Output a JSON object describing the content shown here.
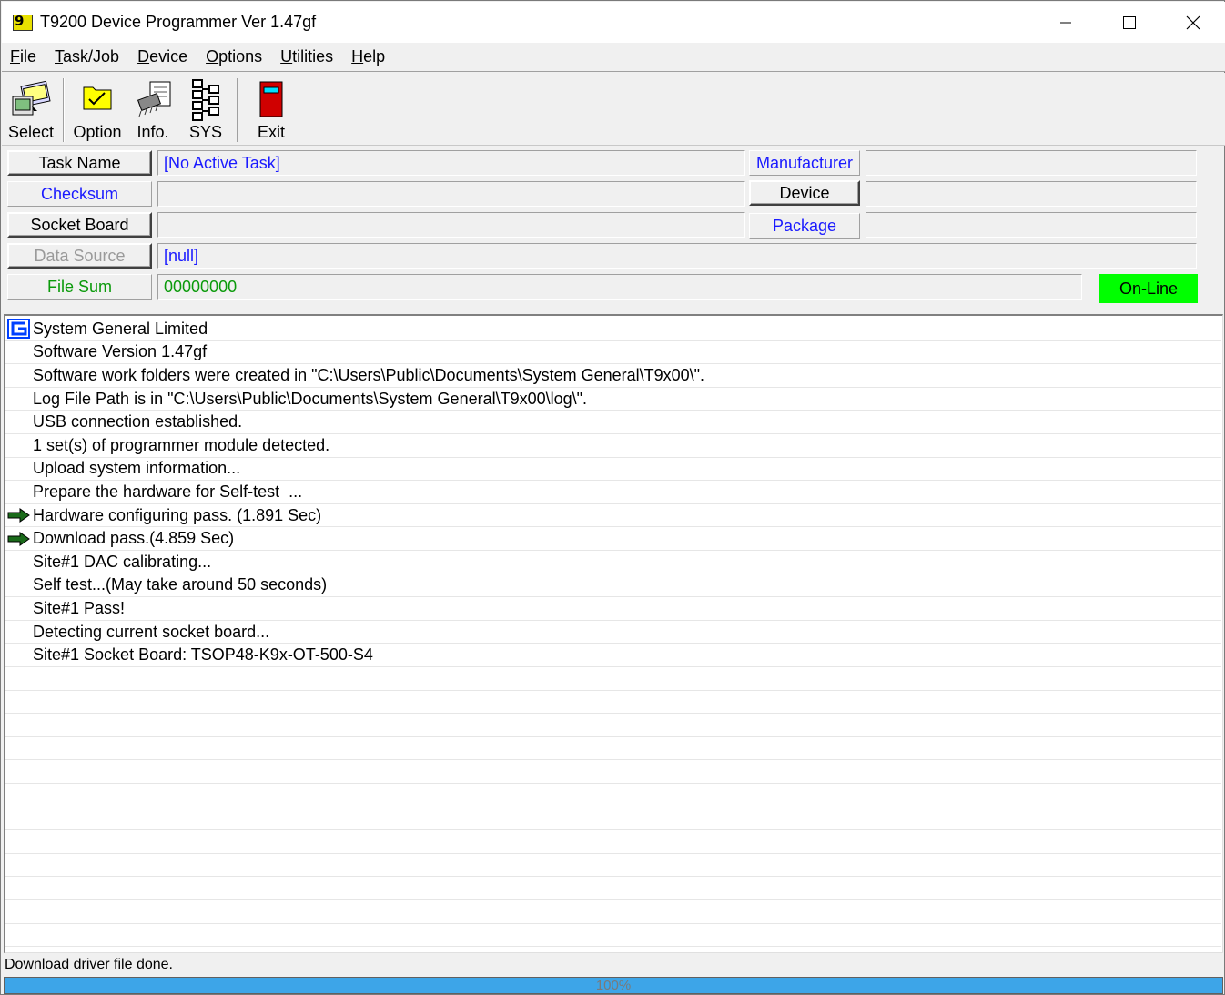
{
  "window": {
    "title": "T9200 Device Programmer Ver 1.47gf",
    "app_icon": "programmer-app-icon"
  },
  "menu": [
    {
      "pre": "",
      "u": "F",
      "post": "ile"
    },
    {
      "pre": "",
      "u": "T",
      "post": "ask/Job"
    },
    {
      "pre": "",
      "u": "D",
      "post": "evice"
    },
    {
      "pre": "",
      "u": "O",
      "post": "ptions"
    },
    {
      "pre": "",
      "u": "U",
      "post": "tilities"
    },
    {
      "pre": "",
      "u": "H",
      "post": "elp"
    }
  ],
  "toolbar": {
    "select": "Select",
    "option": "Option",
    "info": "Info.",
    "sys": "SYS",
    "exit": "Exit"
  },
  "info": {
    "task_name_label": "Task Name",
    "task_name_value": "[No Active Task]",
    "checksum_label": "Checksum",
    "checksum_value": "",
    "socket_board_label": "Socket Board",
    "socket_board_value": "",
    "data_source_label": "Data Source",
    "data_source_value": "[null]",
    "file_sum_label": "File Sum",
    "file_sum_value": "00000000",
    "manufacturer_label": "Manufacturer",
    "manufacturer_value": "",
    "device_label": "Device",
    "device_value": "",
    "package_label": "Package",
    "package_value": "",
    "online_status": "On-Line"
  },
  "colors": {
    "online": "#00ff00",
    "blue_label": "#1a1aff",
    "green_label": "#0a9a0a",
    "progress": "#3da5e8"
  },
  "log": [
    {
      "icon": "sg-logo-icon",
      "text": "System General Limited"
    },
    {
      "icon": "",
      "text": "Software Version 1.47gf"
    },
    {
      "icon": "",
      "text": "Software work folders were created in \"C:\\Users\\Public\\Documents\\System General\\T9x00\\\"."
    },
    {
      "icon": "",
      "text": "Log File Path is in \"C:\\Users\\Public\\Documents\\System General\\T9x00\\log\\\"."
    },
    {
      "icon": "",
      "text": "USB connection established."
    },
    {
      "icon": "",
      "text": "1 set(s) of programmer module detected."
    },
    {
      "icon": "",
      "text": "Upload system information..."
    },
    {
      "icon": "",
      "text": "Prepare the hardware for Self-test  ..."
    },
    {
      "icon": "arrow-right-icon",
      "text": "Hardware configuring pass. (1.891 Sec)"
    },
    {
      "icon": "arrow-right-icon",
      "text": "Download pass.(4.859 Sec)"
    },
    {
      "icon": "",
      "text": "Site#1 DAC calibrating..."
    },
    {
      "icon": "",
      "text": "Self test...(May take around 50 seconds)"
    },
    {
      "icon": "",
      "text": "Site#1 Pass!"
    },
    {
      "icon": "",
      "text": "Detecting current socket board..."
    },
    {
      "icon": "",
      "text": "Site#1 Socket Board: TSOP48-K9x-OT-500-S4"
    }
  ],
  "status": {
    "message": "Download driver file done.",
    "progress_percent": 100,
    "progress_text": "100%"
  }
}
